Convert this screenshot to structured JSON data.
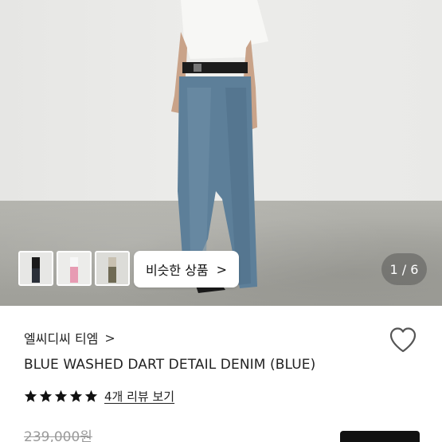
{
  "gallery": {
    "counter": "1 / 6",
    "similar_button_label": "비슷한 상품",
    "similar_button_chevron": ">",
    "thumbnails": [
      "thumbnail-black-outfit",
      "thumbnail-pink-pants",
      "thumbnail-olive-pants"
    ]
  },
  "product": {
    "brand": "엘씨디씨 티엠",
    "brand_chevron": ">",
    "title": "BLUE WASHED DART DETAIL DENIM (BLUE)",
    "rating_stars": 5,
    "review_link": "4개 리뷰 보기",
    "original_price": "239,000원"
  },
  "colors": {
    "star": "#111111",
    "heart_stroke": "#555555",
    "buy_button": "#111111",
    "strike_price": "#9a9a9a"
  }
}
